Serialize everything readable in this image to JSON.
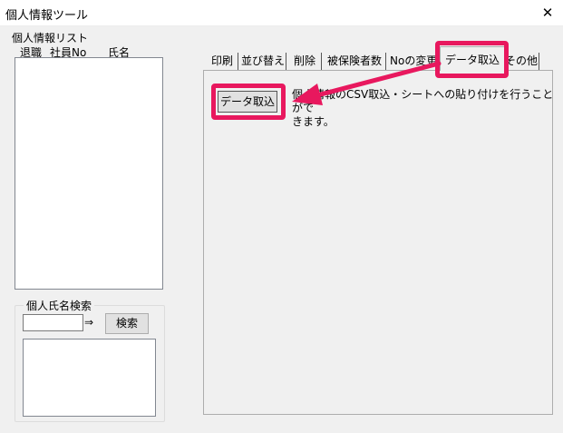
{
  "window": {
    "title": "個人情報ツール",
    "close_glyph": "✕"
  },
  "list": {
    "label": "個人情報リスト",
    "columns": [
      "退職",
      "社員No",
      "氏名"
    ],
    "rows": []
  },
  "search": {
    "legend": "個人氏名検索",
    "input_value": "",
    "arrow": "⇒",
    "button_label": "検索",
    "results": []
  },
  "tabs": {
    "labels": [
      "印刷",
      "並び替え",
      "削除",
      "被保険者数",
      "Noの変更",
      "データ取込",
      "その他"
    ],
    "active_index": 5
  },
  "panel": {
    "import_button_label": "データ取込",
    "description_line1": "個人情報のCSV取込・シートへの貼り付けを行うことがで",
    "description_line2": "きます。"
  },
  "annotation": {
    "color": "#e8185e"
  }
}
